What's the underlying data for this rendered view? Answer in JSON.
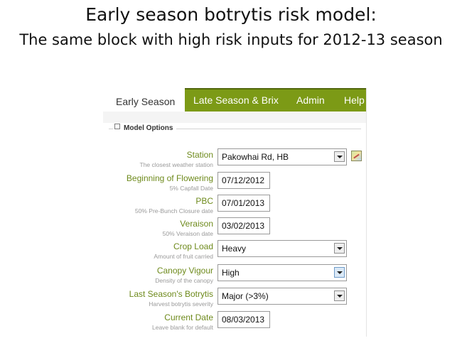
{
  "slide": {
    "title": "Early season botrytis risk model:",
    "subtitle": "The same block with high risk inputs for 2012-13 season"
  },
  "nav": {
    "tabs": [
      {
        "label": "Early Season",
        "active": true
      },
      {
        "label": "Late Season & Brix",
        "active": false
      },
      {
        "label": "Admin",
        "active": false
      },
      {
        "label": "Help",
        "active": false
      }
    ]
  },
  "model_options": {
    "legend": "Model Options",
    "fields": [
      {
        "label": "Station",
        "hint": "The closest weather station",
        "type": "select",
        "value": "Pakowhai Rd, HB",
        "icon": "map-icon"
      },
      {
        "label": "Beginning of Flowering",
        "hint": "5% Capfall Date",
        "type": "date",
        "value": "07/12/2012"
      },
      {
        "label": "PBC",
        "hint": "50% Pre-Bunch Closure date",
        "type": "date",
        "value": "07/01/2013"
      },
      {
        "label": "Veraison",
        "hint": "50% Veraison date",
        "type": "date",
        "value": "03/02/2013"
      },
      {
        "label": "Crop Load",
        "hint": "Amount of fruit carried",
        "type": "select",
        "value": "Heavy"
      },
      {
        "label": "Canopy Vigour",
        "hint": "Density of the canopy",
        "type": "select",
        "value": "High",
        "focused": true
      },
      {
        "label": "Last Season's Botrytis",
        "hint": "Harvest botrytis severity",
        "type": "select",
        "value": "Major (>3%)"
      },
      {
        "label": "Current Date",
        "hint": "Leave blank for default",
        "type": "date",
        "value": "08/03/2013"
      }
    ]
  },
  "colors": {
    "nav_bg": "#7c9a16",
    "label_green": "#6e8a1c",
    "hint_gray": "#9a9a9a"
  }
}
